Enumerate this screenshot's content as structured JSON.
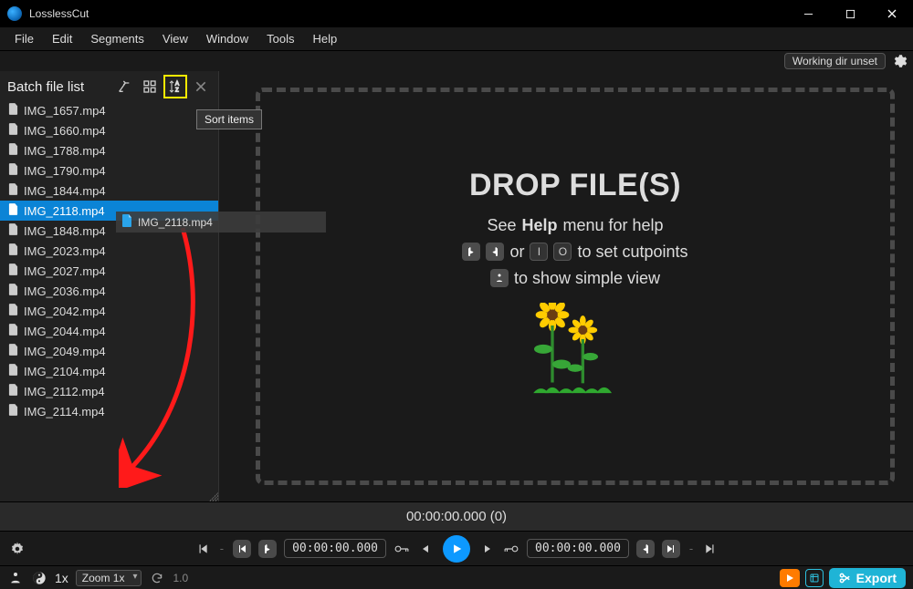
{
  "app": {
    "title": "LosslessCut"
  },
  "menus": [
    "File",
    "Edit",
    "Segments",
    "View",
    "Window",
    "Tools",
    "Help"
  ],
  "topstrip": {
    "working_dir": "Working dir unset"
  },
  "sidebar": {
    "title": "Batch file list",
    "tooltip": "Sort items",
    "files": [
      "IMG_1657.mp4",
      "IMG_1660.mp4",
      "IMG_1788.mp4",
      "IMG_1790.mp4",
      "IMG_1844.mp4",
      "IMG_2118.mp4",
      "IMG_1848.mp4",
      "IMG_2023.mp4",
      "IMG_2027.mp4",
      "IMG_2036.mp4",
      "IMG_2042.mp4",
      "IMG_2044.mp4",
      "IMG_2049.mp4",
      "IMG_2104.mp4",
      "IMG_2112.mp4",
      "IMG_2114.mp4"
    ],
    "selected_index": 5,
    "drag_ghost": "IMG_2118.mp4"
  },
  "dropzone": {
    "title": "DROP FILE(S)",
    "help_prefix": "See",
    "help_bold": "Help",
    "help_suffix": "menu for help",
    "cut_or": "or",
    "cut_text": "to set cutpoints",
    "simple_text": "to show simple view",
    "key_i": "I",
    "key_o": "O"
  },
  "timeline": {
    "display": "00:00:00.000 (0)"
  },
  "controls": {
    "tc_left": "00:00:00.000",
    "tc_right": "00:00:00.000"
  },
  "bottombar": {
    "speed": "1x",
    "zoom_label": "Zoom 1x",
    "fps": "1.0",
    "export_label": "Export"
  }
}
